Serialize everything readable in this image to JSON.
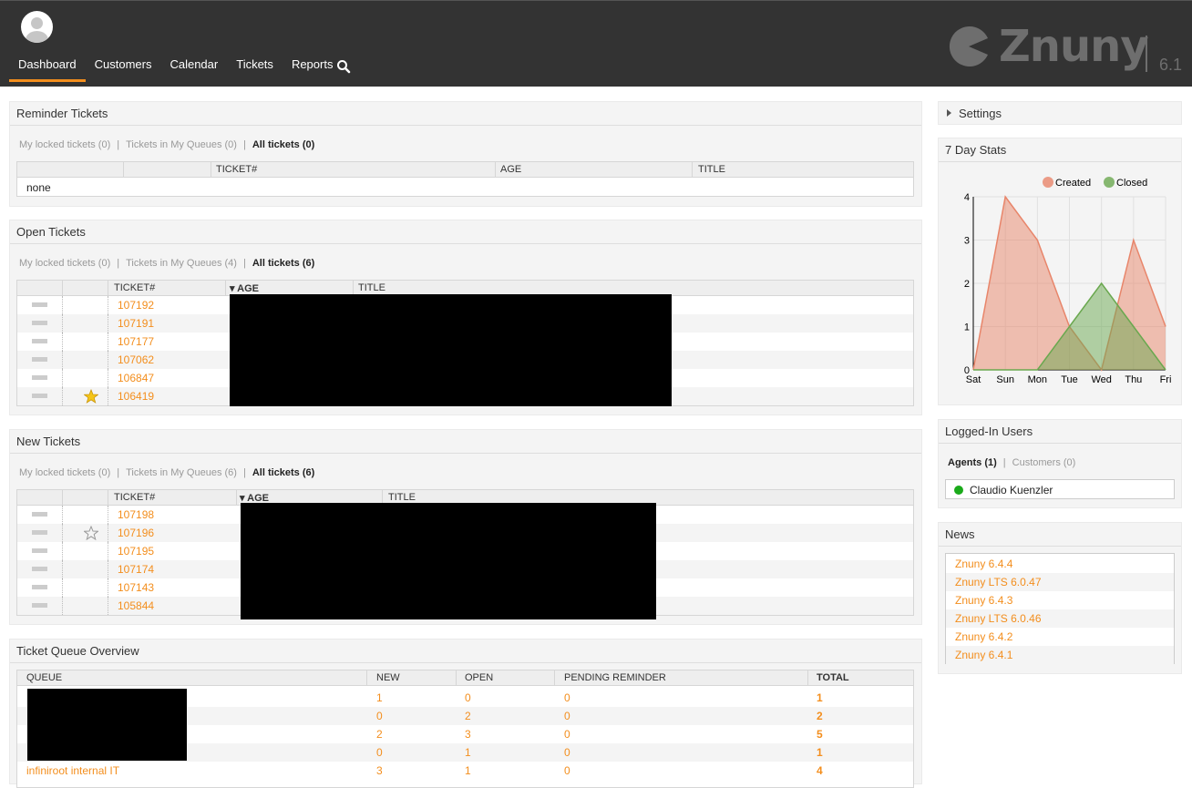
{
  "nav": {
    "items": [
      "Dashboard",
      "Customers",
      "Calendar",
      "Tickets",
      "Reports"
    ],
    "active": "Dashboard"
  },
  "logo": {
    "text": "Znuny",
    "version": "6.1"
  },
  "colors": {
    "accent": "#f38e1d",
    "header_bg": "#333333",
    "created": "#e8856a",
    "closed": "#6aa84f",
    "online": "#1aaa1a"
  },
  "reminder": {
    "title": "Reminder Tickets",
    "filters": [
      "My locked tickets (0)",
      "Tickets in My Queues (0)",
      "All tickets (0)"
    ],
    "columns": [
      "TICKET#",
      "AGE",
      "TITLE"
    ],
    "empty": "none"
  },
  "open": {
    "title": "Open Tickets",
    "filters": [
      "My locked tickets (0)",
      "Tickets in My Queues (4)",
      "All tickets (6)"
    ],
    "columns": [
      "TICKET#",
      "▾ AGE",
      "TITLE"
    ],
    "rows": [
      "107192",
      "107191",
      "107177",
      "107062",
      "106847",
      "106419"
    ]
  },
  "new": {
    "title": "New Tickets",
    "filters": [
      "My locked tickets (0)",
      "Tickets in My Queues (6)",
      "All tickets (6)"
    ],
    "columns": [
      "TICKET#",
      "▾ AGE",
      "TITLE"
    ],
    "rows": [
      "107198",
      "107196",
      "107195",
      "107174",
      "107143",
      "105844"
    ]
  },
  "queue": {
    "title": "Ticket Queue Overview",
    "columns": [
      "QUEUE",
      "NEW",
      "OPEN",
      "PENDING REMINDER",
      "TOTAL"
    ],
    "rows": [
      {
        "queue": "",
        "new": "1",
        "open": "0",
        "pending": "0",
        "total": "1"
      },
      {
        "queue": "",
        "new": "0",
        "open": "2",
        "pending": "0",
        "total": "2"
      },
      {
        "queue": "",
        "new": "2",
        "open": "3",
        "pending": "0",
        "total": "5"
      },
      {
        "queue": "",
        "new": "0",
        "open": "1",
        "pending": "0",
        "total": "1"
      },
      {
        "queue": "infiniroot internal IT",
        "new": "3",
        "open": "1",
        "pending": "0",
        "total": "4"
      }
    ]
  },
  "settings": {
    "title": "Settings"
  },
  "stats": {
    "title": "7 Day Stats",
    "legend": [
      "Created",
      "Closed"
    ]
  },
  "chart_data": {
    "type": "area",
    "categories": [
      "Sat",
      "Sun",
      "Mon",
      "Tue",
      "Wed",
      "Thu",
      "Fri"
    ],
    "series": [
      {
        "name": "Created",
        "values": [
          0,
          4,
          3,
          1,
          0,
          3,
          1
        ]
      },
      {
        "name": "Closed",
        "values": [
          0,
          0,
          0,
          1,
          2,
          1,
          0
        ]
      }
    ],
    "ylim": [
      0,
      4
    ],
    "yticks": [
      "0",
      "1",
      "2",
      "3",
      "4"
    ],
    "legend_position": "top-right",
    "grid": true
  },
  "users": {
    "title": "Logged-In Users",
    "tabs": [
      "Agents (1)",
      "Customers (0)"
    ],
    "list": [
      "Claudio Kuenzler"
    ]
  },
  "news": {
    "title": "News",
    "items": [
      "Znuny 6.4.4",
      "Znuny LTS 6.0.47",
      "Znuny 6.4.3",
      "Znuny LTS 6.0.46",
      "Znuny 6.4.2",
      "Znuny 6.4.1"
    ]
  }
}
